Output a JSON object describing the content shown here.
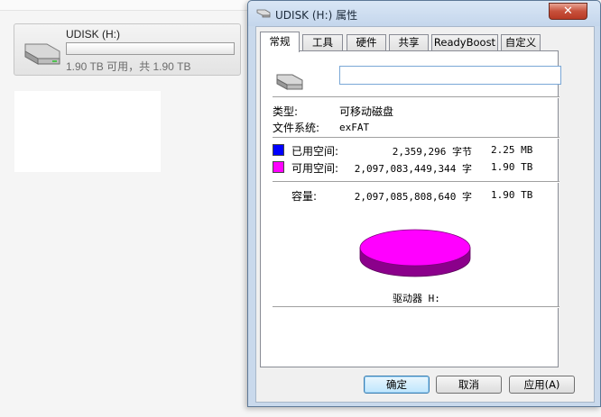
{
  "explorer": {
    "drive_title": "UDISK (H:)",
    "drive_space": "1.90 TB 可用，共 1.90 TB",
    "used_fraction": 0.0
  },
  "dialog": {
    "title": "UDISK (H:) 属性",
    "close_glyph": "✕",
    "tabs": [
      {
        "label": "常规"
      },
      {
        "label": "工具"
      },
      {
        "label": "硬件"
      },
      {
        "label": "共享"
      },
      {
        "label": "ReadyBoost"
      },
      {
        "label": "自定义"
      }
    ],
    "name_value": "",
    "type_label": "类型:",
    "type_value": "可移动磁盘",
    "fs_label": "文件系统:",
    "fs_value": "exFAT",
    "used": {
      "label": "已用空间:",
      "bytes": "2,359,296 字节",
      "size": "2.25 MB",
      "color": "#0000ff"
    },
    "free": {
      "label": "可用空间:",
      "bytes": "2,097,083,449,344 字",
      "size": "1.90 TB",
      "color": "#ff00ff"
    },
    "capacity": {
      "label": "容量:",
      "bytes": "2,097,085,808,640 字",
      "size": "1.90 TB"
    },
    "drive_caption": "驱动器 H:",
    "buttons": {
      "ok": "确定",
      "cancel": "取消",
      "apply": "应用(A)"
    }
  }
}
